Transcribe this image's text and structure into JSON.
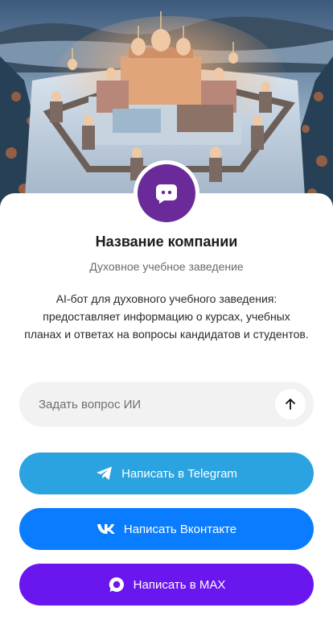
{
  "hero": {
    "icon": "monastery-image"
  },
  "profile": {
    "avatar_icon": "chat-bot-icon",
    "avatar_color": "#6a2a99",
    "company_name": "Название компании",
    "company_type": "Духовное учебное заведение",
    "description": "AI-бот для духовного учебного заведения: предоставляет информацию о курсах, учебных планах и ответах на вопросы кандидатов и студентов."
  },
  "ask": {
    "placeholder": "Задать вопрос ИИ",
    "value": "",
    "send_icon": "arrow-up-icon"
  },
  "buttons": {
    "telegram": {
      "label": "Написать в Telegram",
      "icon": "telegram-icon",
      "color": "#2aa3e0"
    },
    "vk": {
      "label": "Написать Вконтакте",
      "icon": "vk-icon",
      "color": "#0a7cff"
    },
    "max": {
      "label": "Написать в MAX",
      "icon": "max-icon",
      "color": "#6a16ee"
    }
  }
}
